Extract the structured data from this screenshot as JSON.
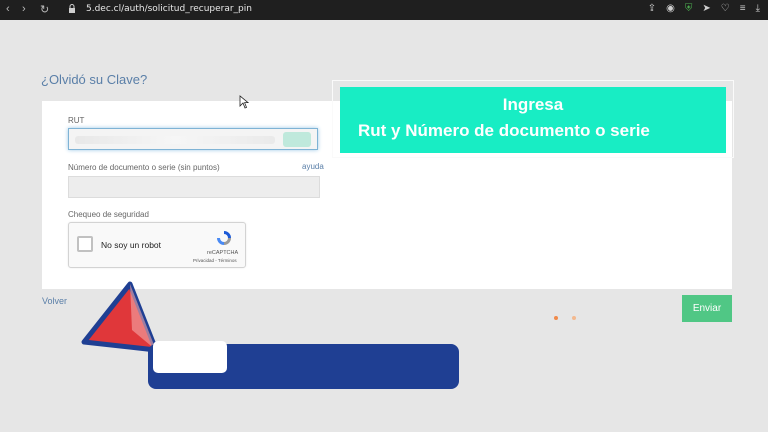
{
  "browser": {
    "url": "5.dec.cl/auth/solicitud_recuperar_pin"
  },
  "page": {
    "title": "¿Olvidó su Clave?"
  },
  "form": {
    "rut_label": "RUT",
    "doc_label": "Número de documento o serie (sin puntos)",
    "help_link": "ayuda",
    "security_label": "Chequeo de seguridad"
  },
  "recaptcha": {
    "text": "No soy un robot",
    "brand": "reCAPTCHA",
    "links": "Privacidad - Términos"
  },
  "actions": {
    "back": "Volver",
    "send": "Enviar"
  },
  "overlay": {
    "line1": "Ingresa",
    "line2": "Rut y Número de documento o serie"
  },
  "colors": {
    "accent": "#18edc4",
    "send_button": "#50c785",
    "link": "#5a7fa8",
    "decor_blue": "#1f3f93",
    "decor_red": "#e0373a",
    "dot1": "#f08a4b",
    "dot2": "#f3b98f"
  },
  "icons": [
    "back-arrow-icon",
    "forward-arrow-icon",
    "reload-icon",
    "lock-icon",
    "share-icon",
    "camera-icon",
    "shield-icon",
    "send-icon",
    "heart-icon",
    "menu-icon",
    "download-icon",
    "recaptcha-logo-icon",
    "mouse-cursor-icon"
  ]
}
